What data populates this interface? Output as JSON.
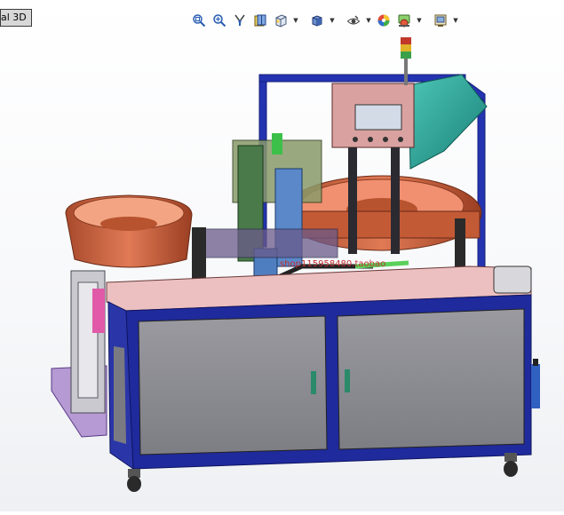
{
  "tab": {
    "label": "al 3D"
  },
  "toolbar": {
    "items": [
      {
        "icon": "zoom-to-fit-icon"
      },
      {
        "icon": "zoom-to-area-icon"
      },
      {
        "icon": "previous-view-icon"
      },
      {
        "icon": "section-view-icon"
      },
      {
        "icon": "view-orientation-icon"
      },
      {
        "icon": "display-style-icon"
      },
      {
        "icon": "hide-show-items-icon"
      },
      {
        "icon": "edit-appearance-icon"
      },
      {
        "icon": "apply-scene-icon"
      },
      {
        "icon": "view-settings-icon"
      }
    ]
  },
  "model": {
    "watermark": "shop115958480.taobao",
    "colors": {
      "frame": "#1f2a9c",
      "panel": "#8c8c90",
      "bowl": "#c8623f",
      "top": "#e7b5b5",
      "hopper": "#2aa89a"
    }
  }
}
